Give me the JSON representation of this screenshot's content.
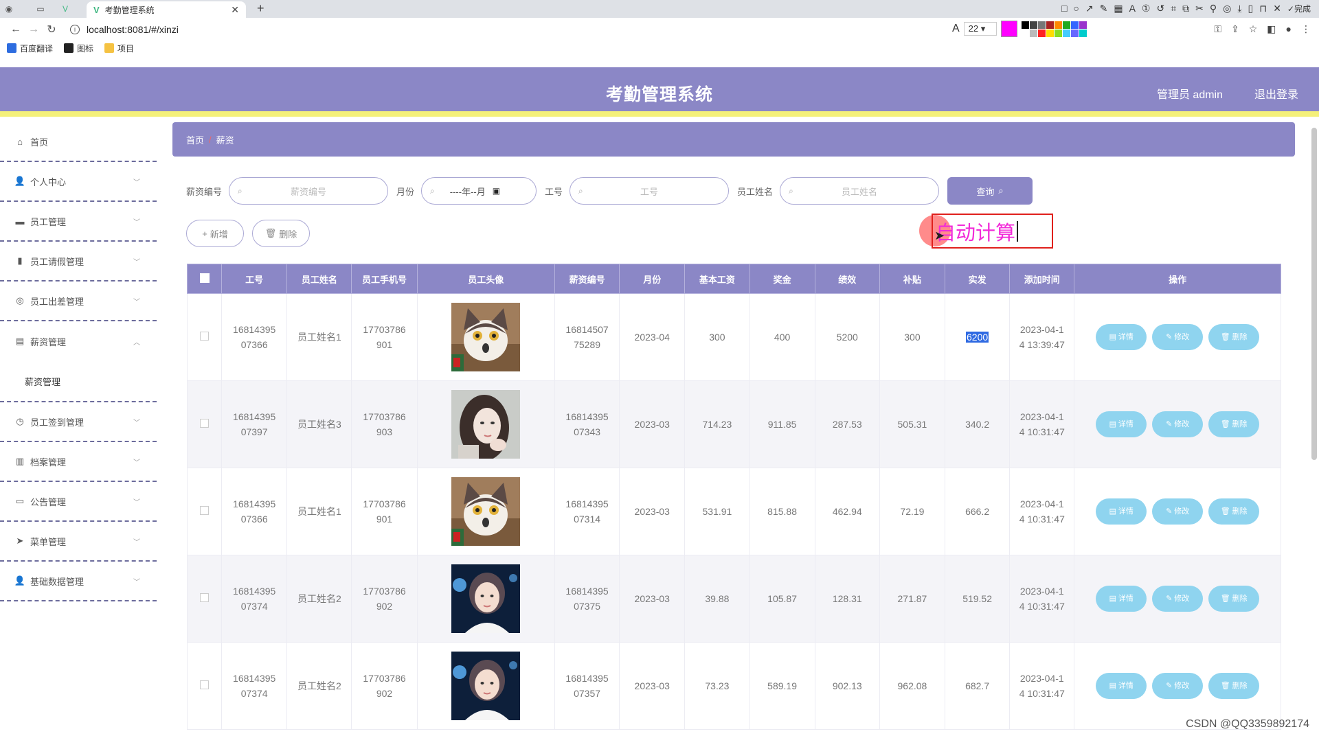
{
  "browser": {
    "tab_title": "考勤管理系统",
    "url": "localhost:8081/#/xinzi",
    "font_size_value": "22",
    "done_label": "完成",
    "bookmarks": [
      {
        "label": "百度翻译",
        "color": "#2d6cdf"
      },
      {
        "label": "图标",
        "color": "#222222"
      },
      {
        "label": "项目",
        "color": "#f5c242"
      }
    ],
    "palette_colors": [
      "#000000",
      "#444444",
      "#777777",
      "#aa2222",
      "#ff8800",
      "#22aa22",
      "#3366ff",
      "#9933cc",
      "#ffffff",
      "#bbbbbb",
      "#ff2222",
      "#ffdd00",
      "#88dd22",
      "#44ccff",
      "#6666ff",
      "#00cccc"
    ]
  },
  "header": {
    "title": "考勤管理系统",
    "user": "管理员 admin",
    "logout": "退出登录"
  },
  "sidebar": {
    "items": [
      {
        "label": "首页",
        "icon": "home-icon"
      },
      {
        "label": "个人中心",
        "icon": "user-icon"
      },
      {
        "label": "员工管理",
        "icon": "car-icon"
      },
      {
        "label": "员工请假管理",
        "icon": "bar-chart-icon"
      },
      {
        "label": "员工出差管理",
        "icon": "globe-icon"
      },
      {
        "label": "薪资管理",
        "icon": "briefcase-icon"
      },
      {
        "label": "员工签到管理",
        "icon": "clock-icon"
      },
      {
        "label": "档案管理",
        "icon": "clipboard-icon"
      },
      {
        "label": "公告管理",
        "icon": "monitor-icon"
      },
      {
        "label": "菜单管理",
        "icon": "paper-plane-icon"
      },
      {
        "label": "基础数据管理",
        "icon": "user-icon"
      }
    ],
    "submenu_label": "薪资管理"
  },
  "breadcrumb": {
    "home": "首页",
    "separator": "/",
    "current": "薪资"
  },
  "search": {
    "salary_no_label": "薪资编号",
    "salary_no_placeholder": "薪资编号",
    "month_label": "月份",
    "month_placeholder": "----年--月",
    "emp_no_label": "工号",
    "emp_no_placeholder": "工号",
    "emp_name_label": "员工姓名",
    "emp_name_placeholder": "员工姓名",
    "query_label": "查询"
  },
  "actions": {
    "add_label": "新增",
    "delete_label": "删除"
  },
  "annotation": {
    "text": "自动计算"
  },
  "table": {
    "columns": [
      "工号",
      "员工姓名",
      "员工手机号",
      "员工头像",
      "薪资编号",
      "月份",
      "基本工资",
      "奖金",
      "绩效",
      "补贴",
      "实发",
      "添加时间",
      "操作"
    ],
    "op_labels": {
      "detail": "详情",
      "edit": "修改",
      "delete": "删除"
    },
    "rows": [
      {
        "emp_no": [
          "16814395",
          "07366"
        ],
        "name": "员工姓名1",
        "phone": [
          "17703786",
          "901"
        ],
        "avatar": "cat",
        "salary_no": [
          "16814507",
          "75289"
        ],
        "month": "2023-04",
        "base": "300",
        "bonus": "400",
        "perf": "5200",
        "allowance": "300",
        "actual": "6200",
        "time": [
          "2023-04-1",
          "4 13:39:47"
        ]
      },
      {
        "emp_no": [
          "16814395",
          "07397"
        ],
        "name": "员工姓名3",
        "phone": [
          "17703786",
          "903"
        ],
        "avatar": "girl",
        "salary_no": [
          "16814395",
          "07343"
        ],
        "month": "2023-03",
        "base": "714.23",
        "bonus": "911.85",
        "perf": "287.53",
        "allowance": "505.31",
        "actual": "340.2",
        "time": [
          "2023-04-1",
          "4 10:31:47"
        ]
      },
      {
        "emp_no": [
          "16814395",
          "07366"
        ],
        "name": "员工姓名1",
        "phone": [
          "17703786",
          "901"
        ],
        "avatar": "cat",
        "salary_no": [
          "16814395",
          "07314"
        ],
        "month": "2023-03",
        "base": "531.91",
        "bonus": "815.88",
        "perf": "462.94",
        "allowance": "72.19",
        "actual": "666.2",
        "time": [
          "2023-04-1",
          "4 10:31:47"
        ]
      },
      {
        "emp_no": [
          "16814395",
          "07374"
        ],
        "name": "员工姓名2",
        "phone": [
          "17703786",
          "902"
        ],
        "avatar": "boy",
        "salary_no": [
          "16814395",
          "07375"
        ],
        "month": "2023-03",
        "base": "39.88",
        "bonus": "105.87",
        "perf": "128.31",
        "allowance": "271.87",
        "actual": "519.52",
        "time": [
          "2023-04-1",
          "4 10:31:47"
        ]
      },
      {
        "emp_no": [
          "16814395",
          "07374"
        ],
        "name": "员工姓名2",
        "phone": [
          "17703786",
          "902"
        ],
        "avatar": "boy",
        "salary_no": [
          "16814395",
          "07357"
        ],
        "month": "2023-03",
        "base": "73.23",
        "bonus": "589.19",
        "perf": "902.13",
        "allowance": "962.08",
        "actual": "682.7",
        "time": [
          "2023-04-1",
          "4 10:31:47"
        ]
      }
    ]
  },
  "watermark": "CSDN @QQ3359892174",
  "colors": {
    "theme": "#8b87c6",
    "accent_bar": "#f4f07a",
    "op_button": "#8fd4ef"
  }
}
